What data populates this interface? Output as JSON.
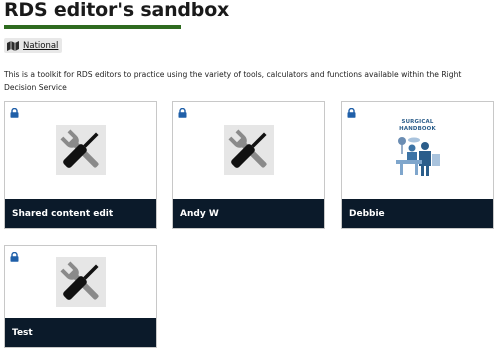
{
  "page": {
    "title": "RDS editor's sandbox",
    "accent_color": "#2e6b1f"
  },
  "tag": {
    "icon": "map-icon",
    "label": "National"
  },
  "description": "This is a toolkit for RDS editors to practice using the variety of tools, calculators and functions available within the Right Decision Service",
  "colors": {
    "card_footer": "#0b1a2a",
    "lock": "#1f5fa8",
    "handbook": "#2b5d8a"
  },
  "cards": [
    {
      "label": "Shared content edit",
      "icon": "tools-icon",
      "locked": true
    },
    {
      "label": "Andy W",
      "icon": "tools-icon",
      "locked": true
    },
    {
      "label": "Debbie",
      "icon": "surgical-handbook-image",
      "locked": true,
      "image_title": "SURGICAL\nHANDBOOK"
    },
    {
      "label": "Test",
      "icon": "tools-icon",
      "locked": true
    }
  ]
}
